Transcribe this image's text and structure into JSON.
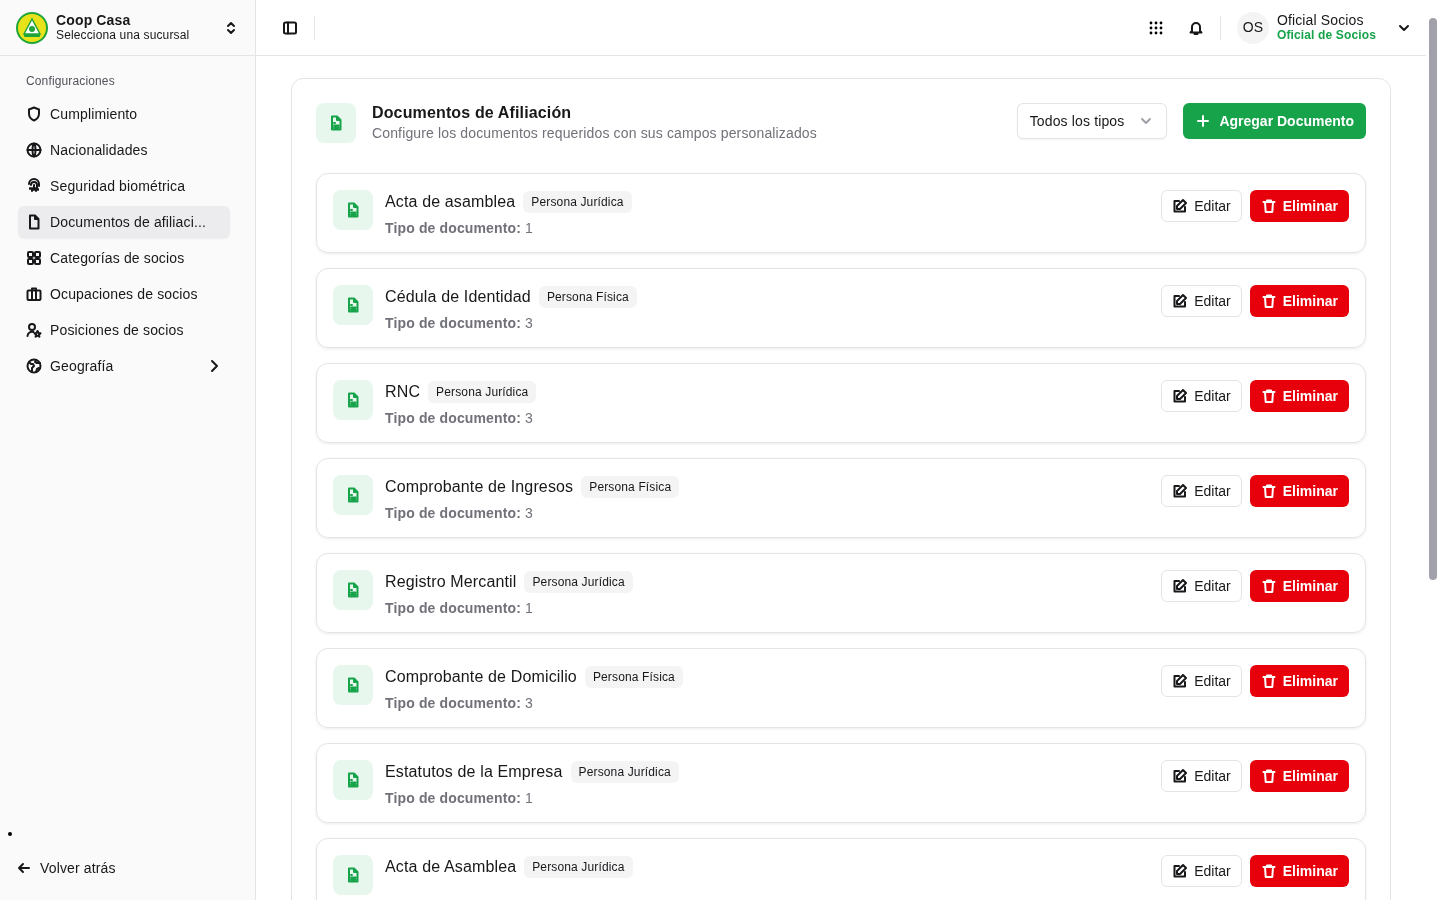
{
  "org": {
    "name": "Coop Casa",
    "subtitle": "Selecciona una sucursal"
  },
  "sidebar": {
    "section": "Configuraciones",
    "items": [
      {
        "label": "Cumplimiento",
        "selected": false,
        "kind": "link"
      },
      {
        "label": "Nacionalidades",
        "selected": false,
        "kind": "link"
      },
      {
        "label": "Seguridad biométrica",
        "selected": false,
        "kind": "link"
      },
      {
        "label": "Documentos de afiliaci...",
        "selected": true,
        "kind": "link"
      },
      {
        "label": "Categorías de socios",
        "selected": false,
        "kind": "link"
      },
      {
        "label": "Ocupaciones de socios",
        "selected": false,
        "kind": "link"
      },
      {
        "label": "Posiciones de socios",
        "selected": false,
        "kind": "link"
      },
      {
        "label": "Geografía",
        "selected": false,
        "kind": "submenu"
      }
    ],
    "back": "Volver atrás"
  },
  "user": {
    "initials": "OS",
    "name": "Oficial Socios",
    "role": "Oficial de Socios"
  },
  "panel": {
    "title": "Documentos de Afiliación",
    "subtitle": "Configure los documentos requeridos con sus campos personalizados",
    "filter": "Todos los tipos",
    "add_button": "Agregar Documento"
  },
  "documents": [
    {
      "name": "Acta de asamblea",
      "badge": "Persona Jurídica",
      "type": "**Tipo de documento:** 1",
      "edit": "Editar",
      "delete": "Eliminar"
    },
    {
      "name": "Cédula de Identidad",
      "badge": "Persona Física",
      "type": "**Tipo de documento:** 3",
      "edit": "Editar",
      "delete": "Eliminar"
    },
    {
      "name": "RNC",
      "badge": "Persona Jurídica",
      "type": "**Tipo de documento:** 3",
      "edit": "Editar",
      "delete": "Eliminar"
    },
    {
      "name": "Comprobante de Ingresos",
      "badge": "Persona Física",
      "type": "**Tipo de documento:** 3",
      "edit": "Editar",
      "delete": "Eliminar"
    },
    {
      "name": "Registro Mercantil",
      "badge": "Persona Jurídica",
      "type": "**Tipo de documento:** 1",
      "edit": "Editar",
      "delete": "Eliminar"
    },
    {
      "name": "Comprobante de Domicilio",
      "badge": "Persona Física",
      "type": "**Tipo de documento:** 3",
      "edit": "Editar",
      "delete": "Eliminar"
    },
    {
      "name": "Estatutos de la Empresa",
      "badge": "Persona Jurídica",
      "type": "**Tipo de documento:** 1",
      "edit": "Editar",
      "delete": "Eliminar"
    },
    {
      "name": "Acta de Asamblea",
      "badge": "Persona Jurídica",
      "edit": "Editar",
      "delete": "Eliminar"
    }
  ]
}
